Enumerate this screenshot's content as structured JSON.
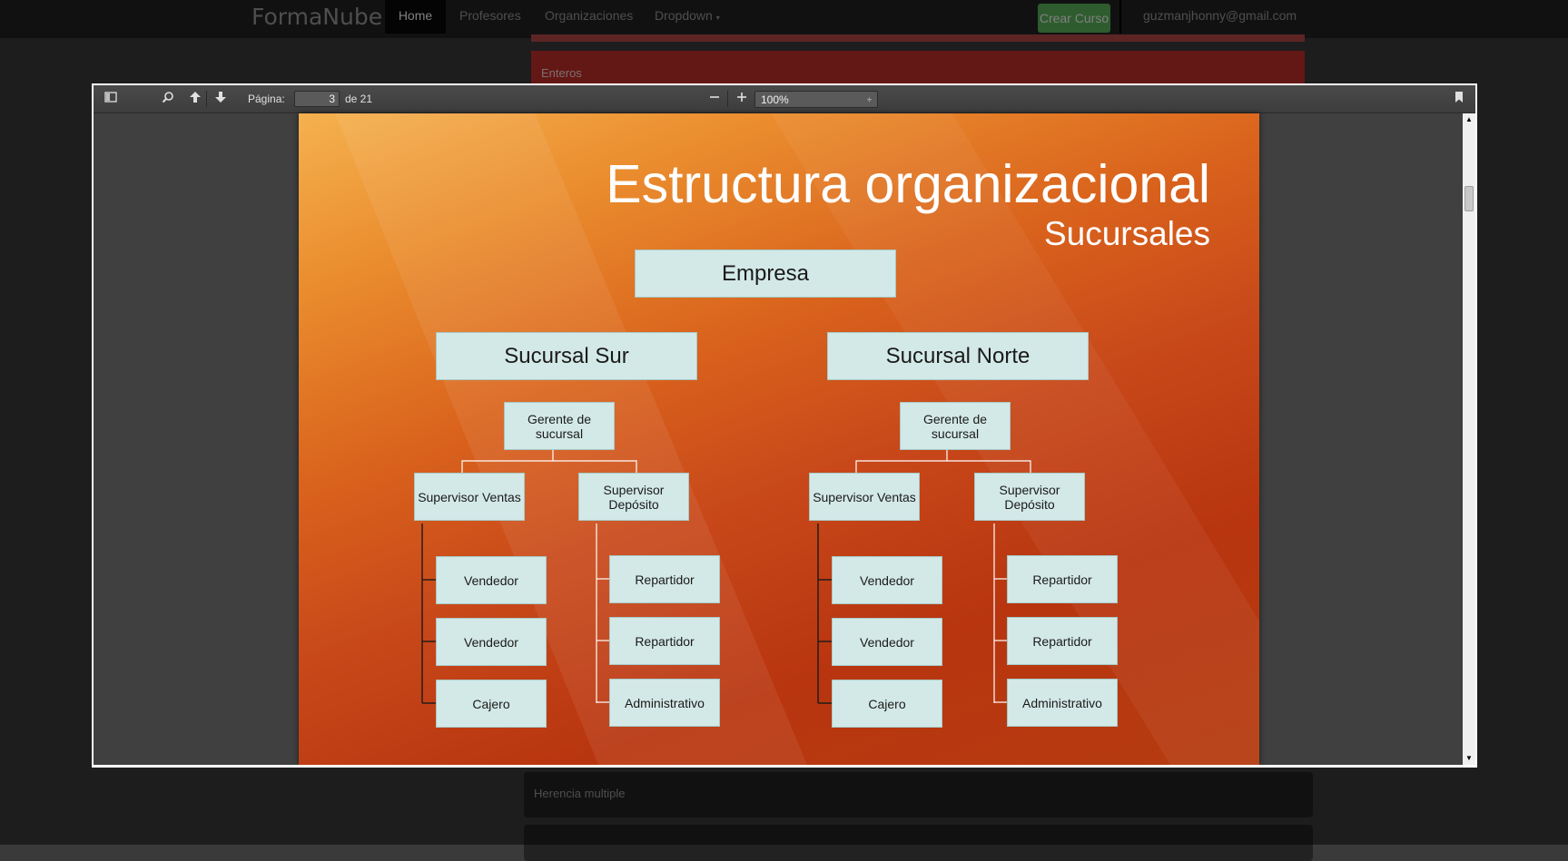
{
  "navbar": {
    "brand": "FormaNube",
    "items": [
      "Home",
      "Profesores",
      "Organizaciones",
      "Dropdown"
    ],
    "create_button": "Crear Curso",
    "user_email": "guzmanjhonny@gmail.com"
  },
  "background": {
    "red_panel_label": "Enteros",
    "dark_panel_label": "Herencia multiple"
  },
  "viewer": {
    "page_label": "Página:",
    "page_current": "3",
    "page_total": "de 21",
    "zoom": "100%",
    "zoom_arrow": "÷"
  },
  "slide": {
    "title": "Estructura organizacional",
    "subtitle": "Sucursales",
    "root": "Empresa",
    "branches": [
      {
        "name": "Sucursal Sur",
        "manager": "Gerente de sucursal",
        "sales_supervisor": "Supervisor Ventas",
        "depot_supervisor": "Supervisor Depósito",
        "sales_staff": [
          "Vendedor",
          "Vendedor",
          "Cajero"
        ],
        "depot_staff": [
          "Repartidor",
          "Repartidor",
          "Administrativo"
        ]
      },
      {
        "name": "Sucursal Norte",
        "manager": "Gerente de sucursal",
        "sales_supervisor": "Supervisor Ventas",
        "depot_supervisor": "Supervisor Depósito",
        "sales_staff": [
          "Vendedor",
          "Vendedor",
          "Cajero"
        ],
        "depot_staff": [
          "Repartidor",
          "Repartidor",
          "Administrativo"
        ]
      }
    ]
  },
  "colors": {
    "node_fill": "#d3e9e7",
    "slide_top": "#f5b14e",
    "slide_bottom": "#b63c10"
  }
}
